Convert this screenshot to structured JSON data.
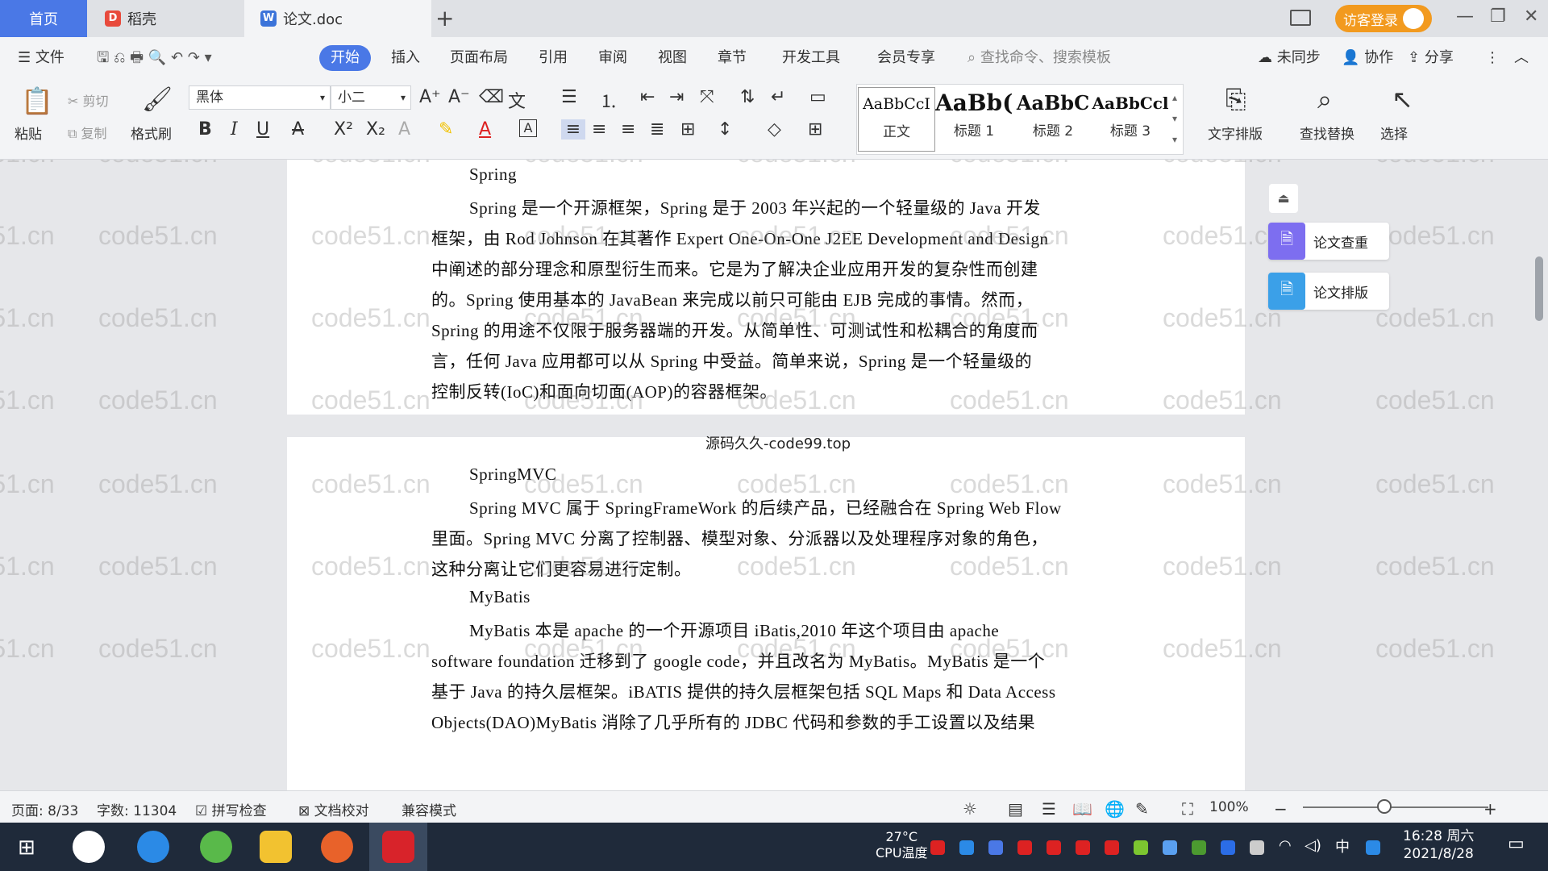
{
  "titlebar": {
    "tabs": [
      {
        "label": "首页"
      },
      {
        "label": "稻壳"
      },
      {
        "label": "论文.doc"
      }
    ],
    "new_tab": "+",
    "login": "访客登录"
  },
  "menubar": {
    "file": "文件",
    "items": [
      "开始",
      "插入",
      "页面布局",
      "引用",
      "审阅",
      "视图",
      "章节",
      "开发工具",
      "会员专享"
    ],
    "search_placeholder": "查找命令、搜索模板",
    "sync": "未同步",
    "collab": "协作",
    "share": "分享"
  },
  "ribbon": {
    "paste": "粘贴",
    "cut": "剪切",
    "copy": "复制",
    "format_painter": "格式刷",
    "font_name": "黑体",
    "font_size": "小二",
    "styles": [
      {
        "sample": "AaBbCcI",
        "label": "正文"
      },
      {
        "sample": "AaBb(",
        "label": "标题 1"
      },
      {
        "sample": "AaBbC",
        "label": "标题 2"
      },
      {
        "sample": "AaBbCcl",
        "label": "标题 3"
      }
    ],
    "text_layout": "文字排版",
    "find_replace": "查找替换",
    "select": "选择"
  },
  "document": {
    "page1_lines": [
      "Spring",
      "Spring 是一个开源框架，Spring 是于 2003 年兴起的一个轻量级的 Java 开发",
      "框架，由 Rod Johnson 在其著作 Expert One-On-One J2EE Development and Design",
      "中阐述的部分理念和原型衍生而来。它是为了解决企业应用开发的复杂性而创建",
      "的。Spring 使用基本的 JavaBean 来完成以前只可能由 EJB 完成的事情。然而，",
      "Spring 的用途不仅限于服务器端的开发。从简单性、可测试性和松耦合的角度而",
      "言，任何 Java 应用都可以从 Spring 中受益。简单来说，Spring 是一个轻量级的",
      "控制反转(IoC)和面向切面(AOP)的容器框架。"
    ],
    "page_label": "源码久久-code99.top",
    "page2_lines": [
      "SpringMVC",
      "Spring MVC 属于 SpringFrameWork 的后续产品，已经融合在 Spring Web Flow",
      "里面。Spring MVC 分离了控制器、模型对象、分派器以及处理程序对象的角色，",
      "这种分离让它们更容易进行定制。",
      "MyBatis",
      "MyBatis 本是 apache 的一个开源项目 iBatis,2010 年这个项目由 apache",
      "software foundation 迁移到了 google code，并且改名为 MyBatis。MyBatis 是一个",
      "基于 Java 的持久层框架。iBATIS 提供的持久层框架包括 SQL Maps 和 Data Access",
      "Objects(DAO)MyBatis 消除了几乎所有的 JDBC 代码和参数的手工设置以及结果"
    ],
    "watermark": "code51.cn"
  },
  "side_panel": {
    "check": "论文查重",
    "layout": "论文排版"
  },
  "statusbar": {
    "page": "页面: 8/33",
    "words": "字数: 11304",
    "spell": "拼写检查",
    "proof": "文档校对",
    "compat": "兼容模式",
    "zoom": "100%"
  },
  "taskbar": {
    "weather": "27°C",
    "weather_sub": "CPU温度",
    "ime": "中",
    "time": "16:28 周六",
    "date": "2021/8/28"
  },
  "colors": {
    "accent": "#4a78e6",
    "login": "#f29a1f"
  }
}
